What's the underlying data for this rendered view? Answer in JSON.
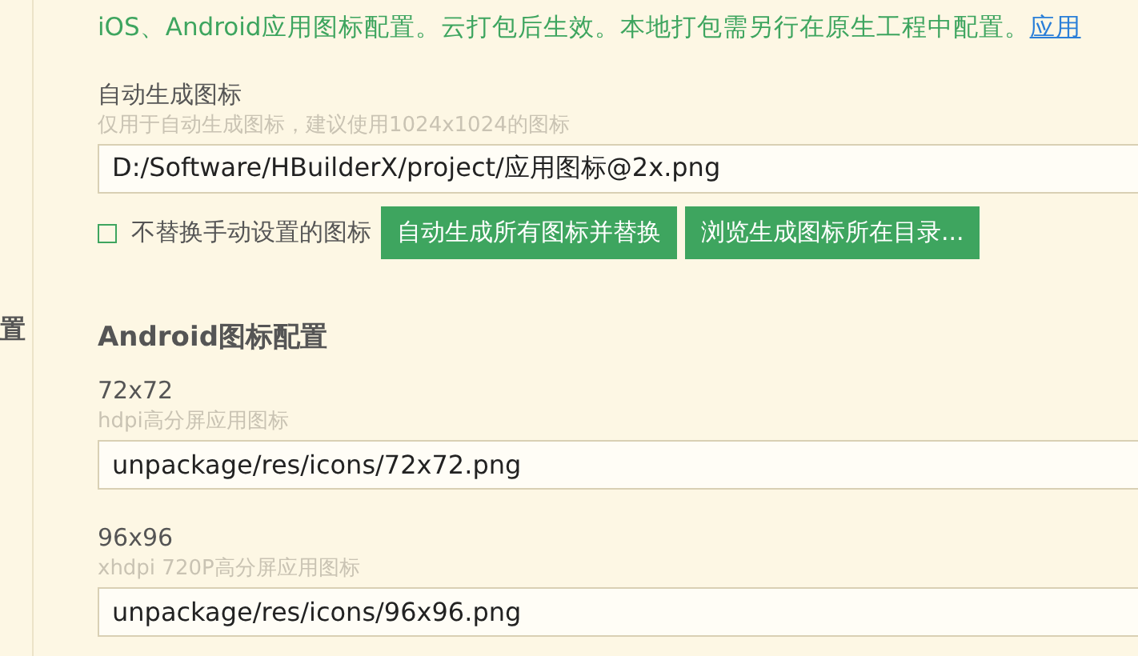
{
  "sidebar": {
    "items": [
      {
        "label": "置"
      }
    ]
  },
  "notice": {
    "text": "iOS、Android应用图标配置。云打包后生效。本地打包需另行在原生工程中配置。",
    "link": "应用"
  },
  "auto_generate": {
    "label": "自动生成图标",
    "hint": "仅用于自动生成图标，建议使用1024x1024的图标",
    "value": "D:/Software/HBuilderX/project/应用图标@2x.png",
    "checkbox": {
      "label": "不替换手动设置的图标",
      "checked": false
    },
    "buttons": [
      "自动生成所有图标并替换",
      "浏览生成图标所在目录..."
    ]
  },
  "android": {
    "title": "Android图标配置",
    "fields": [
      {
        "label": "72x72",
        "hint": "hdpi高分屏应用图标",
        "value": "unpackage/res/icons/72x72.png"
      },
      {
        "label": "96x96",
        "hint": "xhdpi 720P高分屏应用图标",
        "value": "unpackage/res/icons/96x96.png"
      }
    ]
  }
}
